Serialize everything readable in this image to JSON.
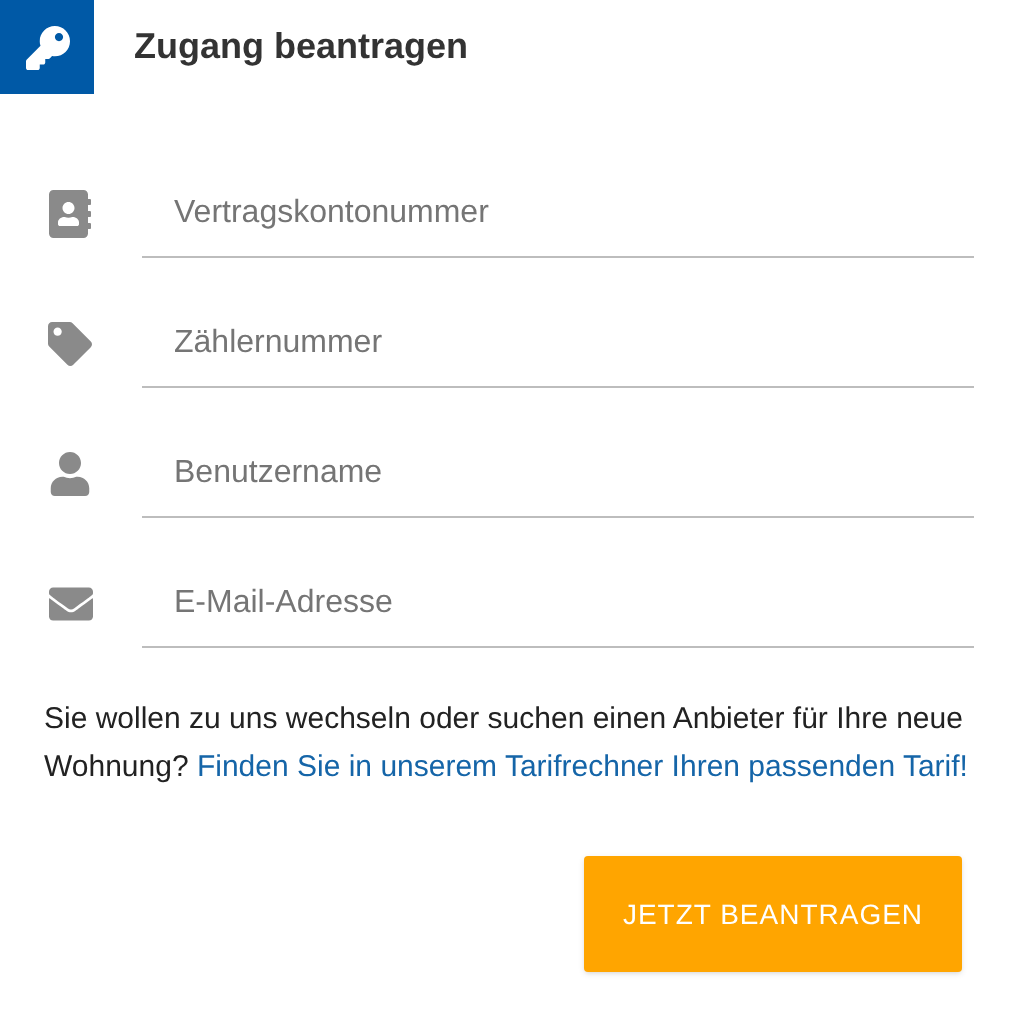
{
  "header": {
    "title": "Zugang beantragen"
  },
  "fields": [
    {
      "kind": "contract",
      "placeholder": "Vertragskontonummer"
    },
    {
      "kind": "tag",
      "placeholder": "Zählernummer"
    },
    {
      "kind": "user",
      "placeholder": "Benutzername"
    },
    {
      "kind": "mail",
      "placeholder": "E-Mail-Adresse"
    }
  ],
  "note": {
    "text": "Sie wollen zu uns wechseln oder suchen einen Anbieter für Ihre neue Wohnung?",
    "link": "Finden Sie in unserem Tarifrechner Ihren passenden Tarif!"
  },
  "submit_button": "JETZT BEANTRAGEN"
}
